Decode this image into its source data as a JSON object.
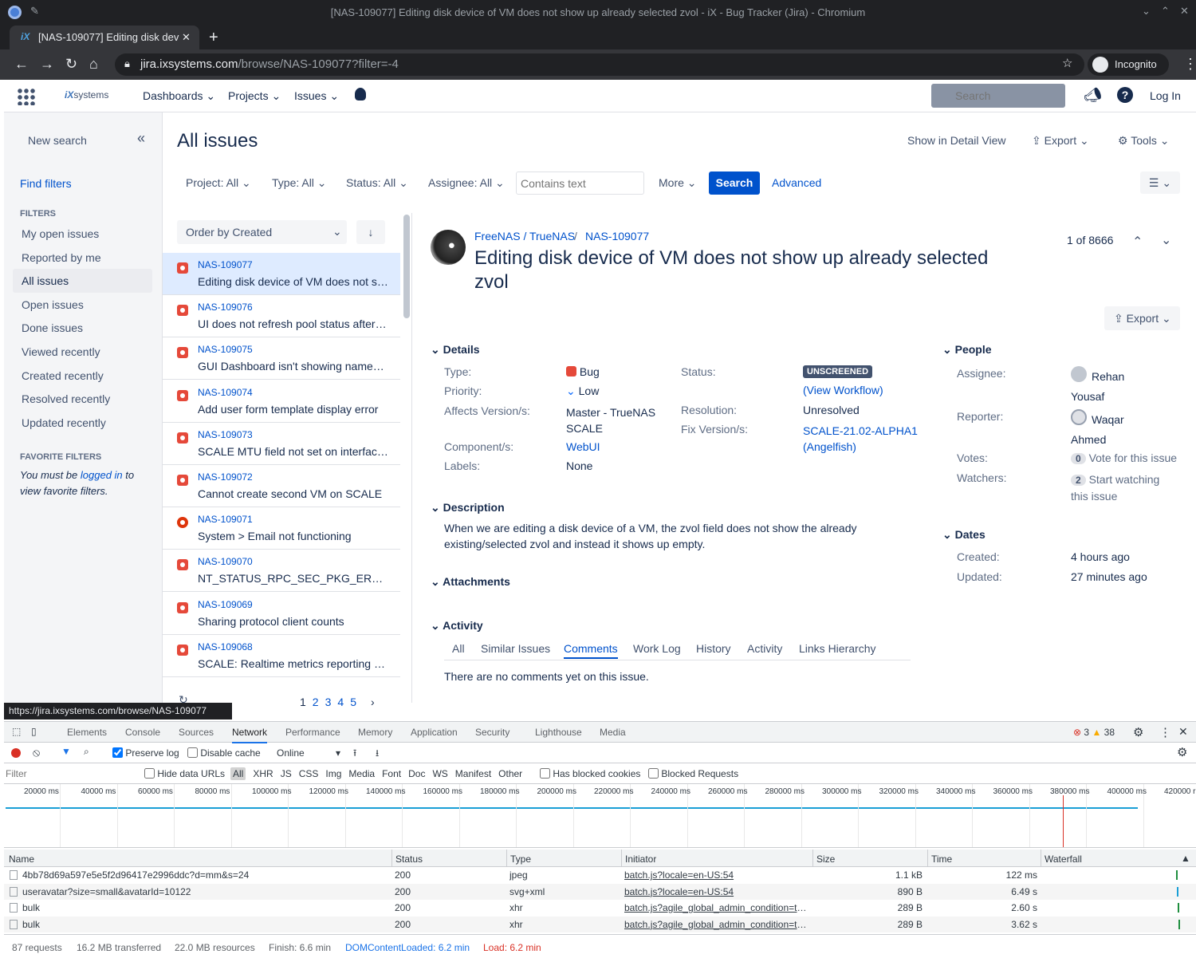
{
  "browser": {
    "window_title": "[NAS-109077] Editing disk device of VM does not show up already selected zvol - iX - Bug Tracker (Jira) - Chromium",
    "tab_title": "[NAS-109077] Editing disk dev",
    "url_host": "jira.ixsystems.com",
    "url_path": "/browse/NAS-109077?filter=-4",
    "profile": "Incognito",
    "status_url": "https://jira.ixsystems.com/browse/NAS-109077"
  },
  "nav": {
    "logo": "systems",
    "dashboards": "Dashboards",
    "projects": "Projects",
    "issues": "Issues",
    "search_placeholder": "Search",
    "login": "Log In"
  },
  "sidebar": {
    "new_search": "New search",
    "find_filters": "Find filters",
    "filters_head": "FILTERS",
    "items": [
      "My open issues",
      "Reported by me",
      "All issues",
      "Open issues",
      "Done issues",
      "Viewed recently",
      "Created recently",
      "Resolved recently",
      "Updated recently"
    ],
    "fav_head": "FAVORITE FILTERS",
    "fav_text1": "You must be ",
    "fav_link": "logged in",
    "fav_text2": " to",
    "fav_text3": "view favorite filters."
  },
  "header": {
    "title": "All issues",
    "detail_view": "Show in Detail View",
    "export": "Export",
    "tools": "Tools"
  },
  "filters": {
    "project": "Project: All",
    "type": "Type: All",
    "status": "Status: All",
    "assignee": "Assignee: All",
    "text_placeholder": "Contains text",
    "more": "More",
    "search": "Search",
    "advanced": "Advanced"
  },
  "list": {
    "order": "Order by Created",
    "rows": [
      {
        "key": "NAS-109077",
        "summary": "Editing disk device of VM does not s…"
      },
      {
        "key": "NAS-109076",
        "summary": "UI does not refresh pool status after…"
      },
      {
        "key": "NAS-109075",
        "summary": "GUI Dashboard isn't showing names…"
      },
      {
        "key": "NAS-109074",
        "summary": "Add user form template display error"
      },
      {
        "key": "NAS-109073",
        "summary": "SCALE MTU field not set on interfac…"
      },
      {
        "key": "NAS-109072",
        "summary": "Cannot create second VM on SCALE"
      },
      {
        "key": "NAS-109071",
        "summary": "System > Email not functioning"
      },
      {
        "key": "NAS-109070",
        "summary": "NT_STATUS_RPC_SEC_PKG_ERRO…"
      },
      {
        "key": "NAS-109069",
        "summary": "Sharing protocol client counts"
      },
      {
        "key": "NAS-109068",
        "summary": "SCALE: Realtime metrics reporting …"
      }
    ],
    "pages": [
      "1",
      "2",
      "3",
      "4",
      "5"
    ]
  },
  "issue": {
    "project": "FreeNAS / TrueNAS",
    "key": "NAS-109077",
    "title_line1": "Editing disk device of VM does not show up already selected",
    "title_line2": "zvol",
    "position": "1 of 8666",
    "export": "Export",
    "details_head": "Details",
    "type_lbl": "Type:",
    "type": "Bug",
    "priority_lbl": "Priority:",
    "priority": "Low",
    "affects_lbl": "Affects Version/s:",
    "affects1": "Master - TrueNAS",
    "affects2": "SCALE",
    "component_lbl": "Component/s:",
    "component": "WebUI",
    "labels_lbl": "Labels:",
    "labels": "None",
    "status_lbl": "Status:",
    "status": "UNSCREENED",
    "workflow": "(View Workflow)",
    "resolution_lbl": "Resolution:",
    "resolution": "Unresolved",
    "fixver_lbl": "Fix Version/s:",
    "fixver1": "SCALE-21.02-ALPHA1",
    "fixver2": "(Angelfish)",
    "desc_head": "Description",
    "desc1": "When we are editing a disk device of a VM, the zvol field does not show the already",
    "desc2": "existing/selected zvol and instead it shows up empty.",
    "attach_head": "Attachments",
    "activity_head": "Activity",
    "activity_tabs": [
      "All",
      "Similar Issues",
      "Comments",
      "Work Log",
      "History",
      "Activity",
      "Links Hierarchy"
    ],
    "no_comments": "There are no comments yet on this issue.",
    "people_head": "People",
    "assignee_lbl": "Assignee:",
    "assignee1": "Rehan",
    "assignee2": "Yousaf",
    "reporter_lbl": "Reporter:",
    "reporter1": "Waqar",
    "reporter2": "Ahmed",
    "votes_lbl": "Votes:",
    "votes": "0",
    "votes_link": "Vote for this issue",
    "watchers_lbl": "Watchers:",
    "watchers": "2",
    "watch_link1": "Start watching",
    "watch_link2": "this issue",
    "dates_head": "Dates",
    "created_lbl": "Created:",
    "created": "4 hours ago",
    "updated_lbl": "Updated:",
    "updated": "27 minutes ago"
  },
  "devtools": {
    "tabs": [
      "Elements",
      "Console",
      "Sources",
      "Network",
      "Performance",
      "Memory",
      "Application",
      "Security",
      "Lighthouse",
      "Media"
    ],
    "errors": "3",
    "warnings": "38",
    "preserve": "Preserve log",
    "disable_cache": "Disable cache",
    "throttle": "Online",
    "filter_placeholder": "Filter",
    "hide_urls": "Hide data URLs",
    "types": [
      "All",
      "XHR",
      "JS",
      "CSS",
      "Img",
      "Media",
      "Font",
      "Doc",
      "WS",
      "Manifest",
      "Other"
    ],
    "blocked_cookies": "Has blocked cookies",
    "blocked_req": "Blocked Requests",
    "ticks": [
      "20000 ms",
      "40000 ms",
      "60000 ms",
      "80000 ms",
      "100000 ms",
      "120000 ms",
      "140000 ms",
      "160000 ms",
      "180000 ms",
      "200000 ms",
      "220000 ms",
      "240000 ms",
      "260000 ms",
      "280000 ms",
      "300000 ms",
      "320000 ms",
      "340000 ms",
      "360000 ms",
      "380000 ms",
      "400000 ms",
      "420000 r"
    ],
    "cols": [
      "Name",
      "Status",
      "Type",
      "Initiator",
      "Size",
      "Time",
      "Waterfall"
    ],
    "rows": [
      {
        "name": "4bb78d69a597e5e5f2d96417e2996ddc?d=mm&s=24",
        "status": "200",
        "type": "jpeg",
        "init": "batch.js?locale=en-US:54",
        "size": "1.1 kB",
        "time": "122 ms"
      },
      {
        "name": "useravatar?size=small&avatarId=10122",
        "status": "200",
        "type": "svg+xml",
        "init": "batch.js?locale=en-US:54",
        "size": "890 B",
        "time": "6.49 s"
      },
      {
        "name": "bulk",
        "status": "200",
        "type": "xhr",
        "init": "batch.js?agile_global_admin_condition=tr…",
        "size": "289 B",
        "time": "2.60 s"
      },
      {
        "name": "bulk",
        "status": "200",
        "type": "xhr",
        "init": "batch.js?agile_global_admin_condition=tr…",
        "size": "289 B",
        "time": "3.62 s"
      }
    ],
    "footer": {
      "requests": "87 requests",
      "transferred": "16.2 MB transferred",
      "resources": "22.0 MB resources",
      "finish": "Finish: 6.6 min",
      "dcl": "DOMContentLoaded: 6.2 min",
      "load": "Load: 6.2 min"
    }
  }
}
